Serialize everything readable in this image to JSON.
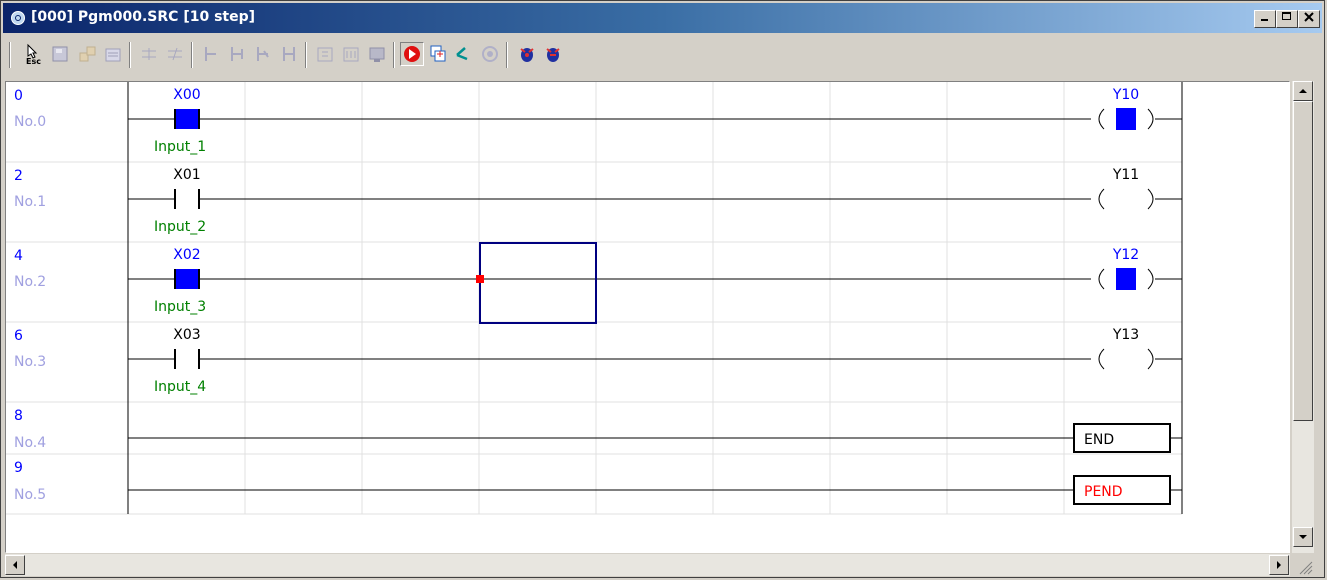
{
  "window": {
    "title": "[000] Pgm000.SRC [10 step]"
  },
  "toolbar": {
    "esc_label": "Esc",
    "buttons": [
      "esc-icon",
      "write-icon",
      "read-icon",
      "compare-icon",
      "insert-icon",
      "delete-icon",
      "copy-icon",
      "cut-icon",
      "paste-icon",
      "find-icon",
      "download-icon",
      "upload-icon",
      "monitor-icon",
      "run-icon",
      "cycle-icon",
      "wire-icon",
      "stop-icon",
      "debug-icon",
      "force-icon"
    ]
  },
  "ladder": {
    "rungs": [
      {
        "step": "0",
        "label": "No.0",
        "contact": "X00",
        "comment": "Input_1",
        "coil": "Y10",
        "active": true
      },
      {
        "step": "2",
        "label": "No.1",
        "contact": "X01",
        "comment": "Input_2",
        "coil": "Y11",
        "active": false
      },
      {
        "step": "4",
        "label": "No.2",
        "contact": "X02",
        "comment": "Input_3",
        "coil": "Y12",
        "active": true
      },
      {
        "step": "6",
        "label": "No.3",
        "contact": "X03",
        "comment": "Input_4",
        "coil": "Y13",
        "active": false
      },
      {
        "step": "8",
        "label": "No.4",
        "instruction": "END"
      },
      {
        "step": "9",
        "label": "No.5",
        "instruction": "PEND"
      }
    ]
  },
  "colors": {
    "active": "#0000ff",
    "comment": "#008000",
    "label": "#a0a0e0",
    "pend": "#ff0000",
    "cursor": "#000080"
  }
}
